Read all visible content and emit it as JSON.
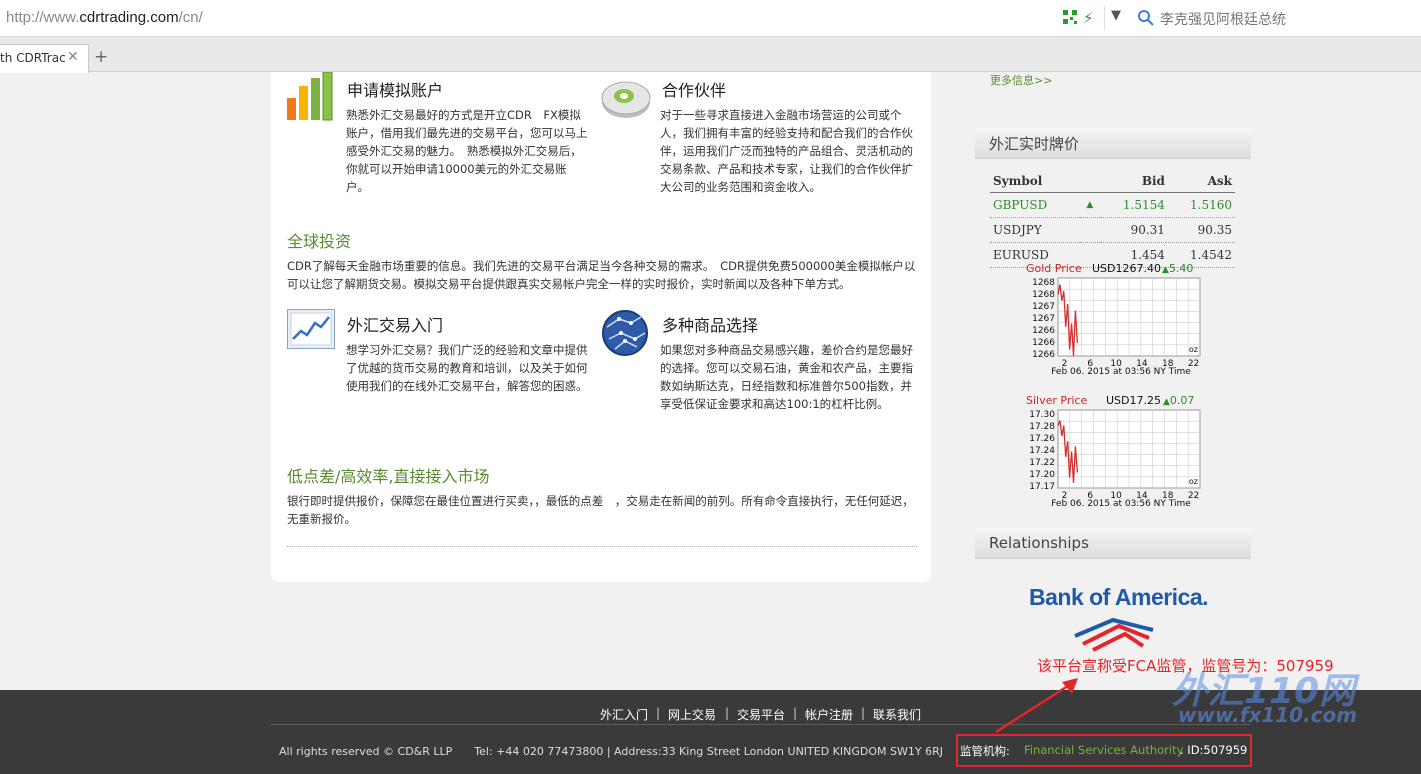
{
  "browser": {
    "url_prefix": "http://www.",
    "url_domain": "cdrtrading.com",
    "url_suffix": "/cn/",
    "search_text": "李克强见阿根廷总统",
    "tab_title": "th CDRTrac",
    "close_glyph": "✕",
    "new_tab_glyph": "+"
  },
  "features": [
    {
      "title": "申请模拟账户",
      "body": "熟悉外汇交易最好的方式是开立CDR　FX模拟账户，借用我们最先进的交易平台，您可以马上感受外汇交易的魅力。　熟悉模拟外汇交易后，你就可以开始申请10000美元的外汇交易账户。",
      "icon": "bar-chart-icon"
    },
    {
      "title": "合作伙伴",
      "body": "对于一些寻求直接进入金融市场营运的公司或个人，我们拥有丰富的经验支持和配合我们的合作伙伴，运用我们广泛而独特的产品组合、灵活机动的交易条款、产品和技术专家，让我们的合作伙伴扩大公司的业务范围和资金收入。",
      "icon": "disc-icon"
    },
    {
      "title": "外汇交易入门",
      "body": "想学习外汇交易？我们广泛的经验和文章中提供了优越的货币交易的教育和培训，以及关于如何使用我们的在线外汇交易平台，解答您的困惑。",
      "icon": "line-chart-icon"
    },
    {
      "title": "多种商品选择",
      "body": "如果您对多种商品交易感兴趣，差价合约是您最好的选择。您可以交易石油，黄金和农产品，主要指数如纳斯达克，日经指数和标准普尔500指数，并享受低保证金要求和高达100:1的杠杆比例。",
      "icon": "globe-icon"
    }
  ],
  "sections": {
    "global_title": "全球投资",
    "global_body": "CDR了解每天金融市场重要的信息。我们先进的交易平台满足当今各种交易的需求。　CDR提供免费500000美金模拟帐户以可以让您了解期货交易。模拟交易平台提供跟真实交易帐户完全一样的实时报价，实时新闻以及各种下单方式。",
    "low_spread_title": "低点差/高效率,直接接入市场",
    "low_spread_body": "银行即时提供报价，保障您在最佳位置进行买卖，，最低的点差　，交易走在新闻的前列。所有命令直接执行，无任何延迟，无重新报价。"
  },
  "sidebar": {
    "more_link": "更多信息>>",
    "quotes_title": "外汇实时牌价",
    "relationships_title": "Relationships",
    "bank_name": "Bank of America."
  },
  "quotes": {
    "headers": [
      "Symbol",
      "Bid",
      "Ask"
    ],
    "rows": [
      {
        "symbol": "GBPUSD",
        "bid": "1.5154",
        "ask": "1.5160",
        "trend": "up"
      },
      {
        "symbol": "USDJPY",
        "bid": "90.31",
        "ask": "90.35",
        "trend": ""
      },
      {
        "symbol": "EURUSD",
        "bid": "1.454",
        "ask": "1.4542",
        "trend": ""
      }
    ]
  },
  "chart_data": [
    {
      "type": "line",
      "title": "Gold Price",
      "price_label": "USD1267.40",
      "change": "5.40",
      "yticks": [
        "1268",
        "1268",
        "1267",
        "1267",
        "1266",
        "1266",
        "1266"
      ],
      "xticks": [
        "2",
        "6",
        "10",
        "14",
        "18",
        "22"
      ],
      "unit": "oz",
      "timestamp": "Feb 06, 2015 at 03:56 NY Time",
      "x": [
        1,
        1.3,
        1.6,
        1.9,
        2.2,
        2.5,
        2.8,
        3.1,
        3.4,
        3.7,
        4.0
      ],
      "y": [
        1267.8,
        1268.1,
        1267.6,
        1267.9,
        1266.8,
        1267.5,
        1266.1,
        1266.9,
        1265.9,
        1267.3,
        1266.3
      ],
      "ylim": [
        1265.9,
        1268.3
      ],
      "xlim": [
        1,
        23
      ]
    },
    {
      "type": "line",
      "title": "Silver Price",
      "price_label": "USD17.25",
      "change": "0.07",
      "yticks": [
        "17.30",
        "17.28",
        "17.26",
        "17.24",
        "17.22",
        "17.20",
        "17.17"
      ],
      "xticks": [
        "2",
        "6",
        "10",
        "14",
        "18",
        "22"
      ],
      "unit": "oz",
      "timestamp": "Feb 06, 2015 at 03:56 NY Time",
      "x": [
        1,
        1.3,
        1.6,
        1.9,
        2.2,
        2.5,
        2.8,
        3.1,
        3.4,
        3.7,
        4.0
      ],
      "y": [
        17.28,
        17.29,
        17.26,
        17.28,
        17.22,
        17.25,
        17.18,
        17.23,
        17.17,
        17.24,
        17.19
      ],
      "ylim": [
        17.16,
        17.31
      ],
      "xlim": [
        1,
        23
      ]
    }
  ],
  "footer": {
    "nav": [
      "外汇入门",
      "网上交易",
      "交易平台",
      "帐户注册",
      "联系我们"
    ],
    "separator": "|",
    "copyright": "All rights reserved © CD&R LLP　　Tel: +44 020 77473800 | Address:33 King Street London UNITED KINGDOM SW1Y 6RJ",
    "regulator_label": "监管机构:",
    "regulator_name": "Financial Services Authority",
    "regulator_id": ". ID:507959"
  },
  "annotation": {
    "claim": "该平台宣称受FCA监管，监管号为：507959",
    "watermark_big": "外汇110网",
    "watermark_small": "www.fx110.com",
    "color": "#e3262b"
  },
  "colors": {
    "green": "#5c8a32",
    "up": "#2e8b2e",
    "red": "#e3262b"
  }
}
